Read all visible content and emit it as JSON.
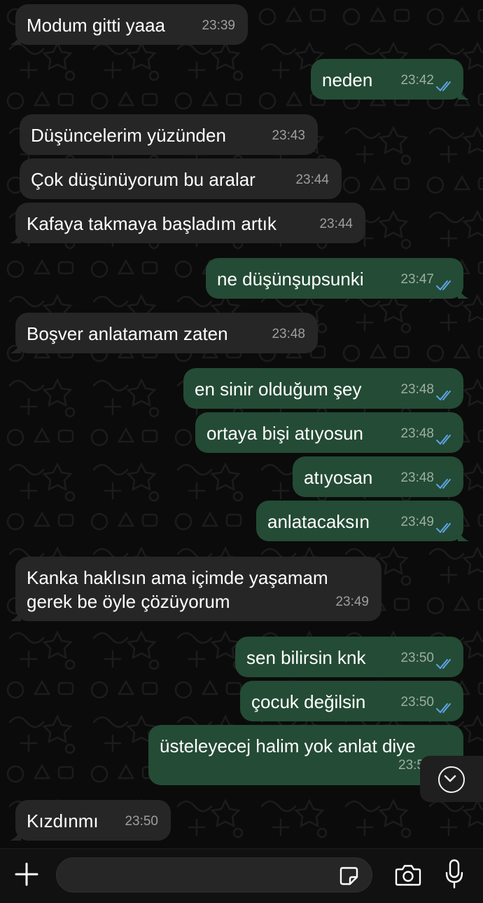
{
  "colors": {
    "incoming_bubble": "#262626",
    "outgoing_bubble": "#244b35",
    "read_ticks": "#5ea3e6",
    "background": "#0b0b0b"
  },
  "messages": [
    {
      "direction": "in",
      "text": "Modum gitti yaaa",
      "time": "23:39"
    },
    {
      "direction": "out",
      "text": "neden",
      "time": "23:42",
      "status": "read"
    },
    {
      "direction": "in",
      "text": "Düşüncelerim yüzünden",
      "time": "23:43"
    },
    {
      "direction": "in",
      "text": "Çok düşünüyorum bu aralar",
      "time": "23:44"
    },
    {
      "direction": "in",
      "text": "Kafaya takmaya başladım artık",
      "time": "23:44"
    },
    {
      "direction": "out",
      "text": "ne düşünşupsunki",
      "time": "23:47",
      "status": "read"
    },
    {
      "direction": "in",
      "text": "Boşver anlatamam zaten",
      "time": "23:48"
    },
    {
      "direction": "out",
      "text": "en sinir olduğum şey",
      "time": "23:48",
      "status": "read"
    },
    {
      "direction": "out",
      "text": "ortaya bişi atıyosun",
      "time": "23:48",
      "status": "read"
    },
    {
      "direction": "out",
      "text": "atıyosan",
      "time": "23:48",
      "status": "read"
    },
    {
      "direction": "out",
      "text": "anlatacaksın",
      "time": "23:49",
      "status": "read"
    },
    {
      "direction": "in",
      "text_line1": "Kanka haklısın ama içimde yaşamam",
      "text_line2": "gerek be öyle çözüyorum",
      "time": "23:49"
    },
    {
      "direction": "out",
      "text": "sen bilirsin knk",
      "time": "23:50",
      "status": "read"
    },
    {
      "direction": "out",
      "text": "çocuk değilsin",
      "time": "23:50",
      "status": "read"
    },
    {
      "direction": "out",
      "text": "üsteleyecej halim yok anlat diye",
      "time": "23:5",
      "status": "read"
    },
    {
      "direction": "in",
      "text": "Kızdınmı",
      "time": "23:50"
    }
  ],
  "scroll_to_bottom": {
    "icon": "chevron-down-icon"
  },
  "composer": {
    "attach_icon": "plus-icon",
    "sticker_icon": "sticker-icon",
    "camera_icon": "camera-icon",
    "mic_icon": "microphone-icon",
    "input_value": ""
  }
}
